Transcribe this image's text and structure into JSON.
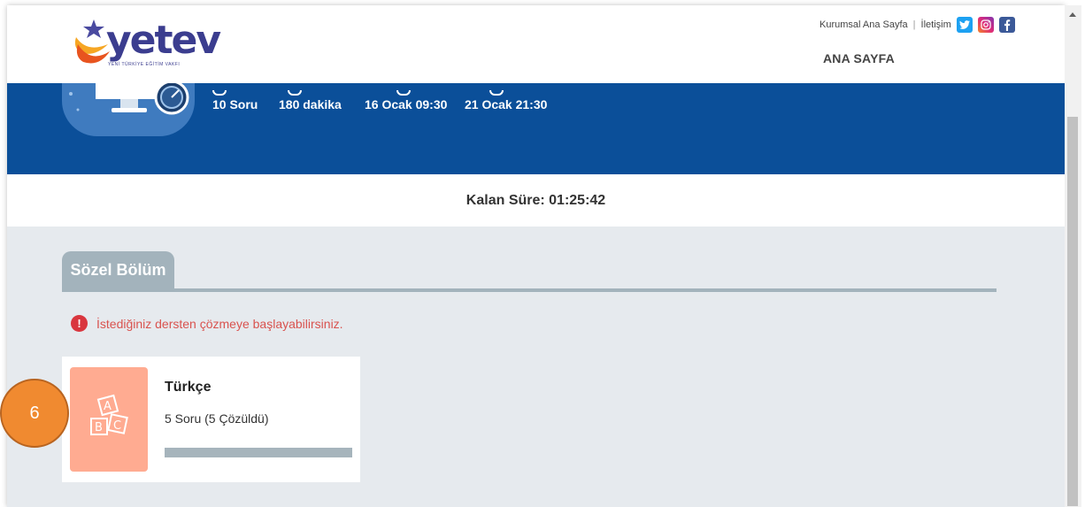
{
  "brand": {
    "logo_word": "yetev",
    "logo_tagline": "YENİ TÜRKİYE EĞİTİM VAKFI"
  },
  "top_links": {
    "corporate": "Kurumsal Ana Sayfa",
    "separator": "|",
    "contact": "İletişim",
    "social": [
      {
        "icon": "twitter-icon",
        "glyph": "t",
        "color": "#1da1f2"
      },
      {
        "icon": "instagram-icon",
        "glyph": "◎",
        "color": "#dd2a7b"
      },
      {
        "icon": "facebook-icon",
        "glyph": "f",
        "color": "#3b5998"
      }
    ]
  },
  "nav": {
    "home": "ANA SAYFA"
  },
  "exam_stats": {
    "questions": "10 Soru",
    "duration": "180 dakika",
    "start": "16 Ocak 09:30",
    "end": "21 Ocak 21:30"
  },
  "timer": {
    "label": "Kalan Süre: 01:25:42"
  },
  "section": {
    "title": "Sözel Bölüm"
  },
  "alert": {
    "text": "İstediğiniz dersten çözmeye başlayabilirsiniz."
  },
  "course": {
    "title": "Türkçe",
    "subtitle": "5 Soru (5 Çözüldü)",
    "progress": 1.0,
    "icon": "abc-blocks-icon"
  },
  "callout": {
    "number": "6"
  },
  "colors": {
    "banner": "#0b4f99",
    "alert": "#d9534f",
    "thumb": "#ffab91",
    "callout": "#f08a30"
  }
}
